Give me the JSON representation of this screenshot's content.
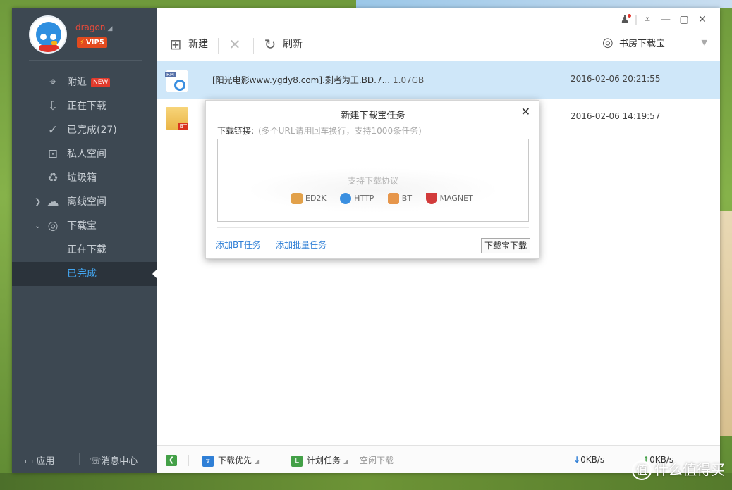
{
  "user": {
    "name": "dragon",
    "vip": "VIP5"
  },
  "sidebar": {
    "items": [
      {
        "label": "附近",
        "icon": "location-pin-icon",
        "badge": "NEW"
      },
      {
        "label": "正在下载",
        "icon": "download-icon"
      },
      {
        "label": "已完成(27)",
        "icon": "check-circle-icon"
      },
      {
        "label": "私人空间",
        "icon": "lock-icon"
      },
      {
        "label": "垃圾箱",
        "icon": "trash-icon"
      },
      {
        "label": "离线空间",
        "icon": "cloud-download-icon"
      },
      {
        "label": "下载宝",
        "icon": "download-box-icon"
      },
      {
        "label": "正在下载"
      },
      {
        "label": "已完成"
      }
    ],
    "footer": {
      "apps": "应用",
      "messages": "消息中心"
    }
  },
  "toolbar": {
    "new": "新建",
    "refresh": "刷新",
    "device": "书房下载宝"
  },
  "files": [
    {
      "name": "[阳光电影www.ygdy8.com].剩者为王.BD.7...",
      "size": "1.07GB",
      "time": "2016-02-06 20:21:55",
      "type": "RM"
    },
    {
      "name": "",
      "size": "",
      "time": "2016-02-06 14:19:57",
      "type": "BT"
    }
  ],
  "dialog": {
    "title": "新建下载宝任务",
    "link_label": "下载链接:",
    "link_hint": "(多个URL请用回车换行，支持1000条任务)",
    "support_label": "支持下载协议",
    "protocols": [
      "ED2K",
      "HTTP",
      "BT",
      "MAGNET"
    ],
    "add_bt": "添加BT任务",
    "add_batch": "添加批量任务",
    "submit": "下载宝下载"
  },
  "statusbar": {
    "priority": "下载优先",
    "schedule": "计划任务",
    "idle": "空闲下载",
    "down_speed": "0KB/s",
    "up_speed": "0KB/s"
  },
  "watermark": "什么值得买"
}
